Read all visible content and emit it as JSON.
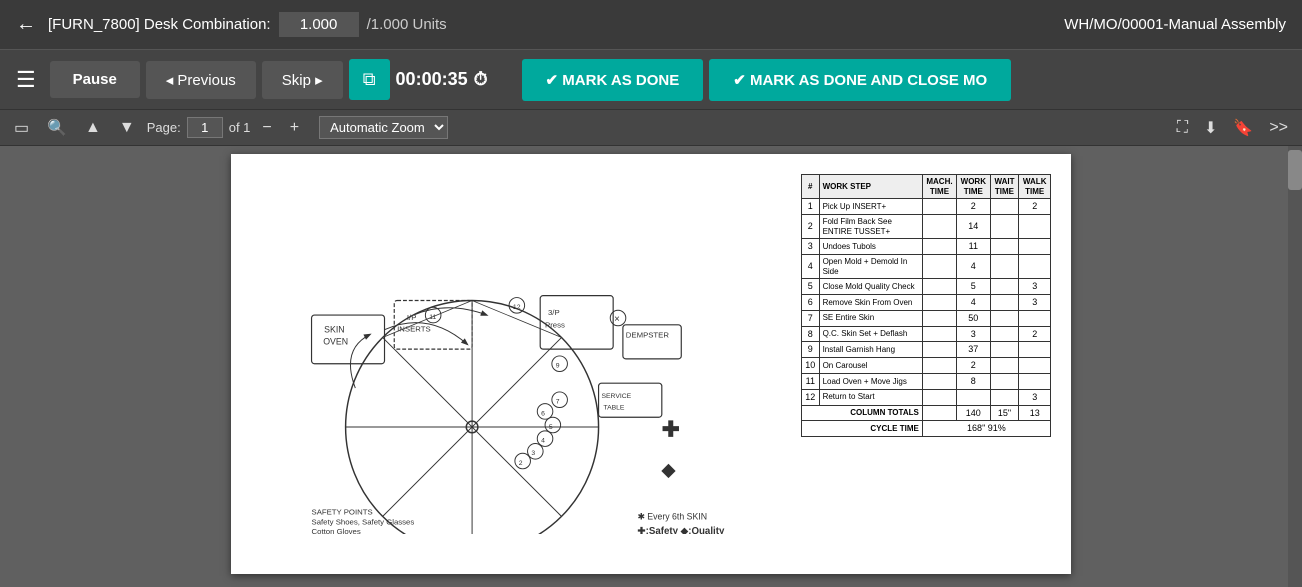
{
  "topbar": {
    "back_icon": "←",
    "title": "[FURN_7800] Desk Combination:",
    "quantity": "1.000",
    "units": "/1.000 Units",
    "mo_ref": "WH/MO/00001-Manual Assembly"
  },
  "actionbar": {
    "menu_icon": "☰",
    "pause_label": "Pause",
    "previous_label": "◂ Previous",
    "skip_label": "Skip ▸",
    "copy_icon": "⧉",
    "timer": "00:00:35",
    "timer_icon": "⏱",
    "mark_done_label": "✔ MARK AS DONE",
    "mark_done_close_label": "✔ MARK AS DONE AND CLOSE MO"
  },
  "pdf_toolbar": {
    "toggle_sidebar_icon": "▭",
    "search_icon": "🔍",
    "prev_page_icon": "▲",
    "next_page_icon": "▼",
    "page_label": "Page:",
    "page_current": "1",
    "page_total": "of 1",
    "zoom_out_icon": "−",
    "zoom_in_icon": "+",
    "zoom_level": "Automatic Zoom",
    "fullscreen_icon": "⛶",
    "download_icon": "⬇",
    "bookmark_icon": "🔖",
    "more_icon": ">>"
  },
  "work_steps": {
    "headers": [
      "#",
      "WORK STEP",
      "MACH. TIME",
      "WORK TIME",
      "WAIT TIME",
      "WALK TIME"
    ],
    "rows": [
      [
        "1",
        "Pick Up INSERT+",
        "",
        "2",
        "",
        "2"
      ],
      [
        "2",
        "Fold Film Back See ENTIRE TUSSET+",
        "",
        "14",
        "",
        ""
      ],
      [
        "3",
        "Undoes Tubols",
        "",
        "11",
        "",
        ""
      ],
      [
        "4",
        "Open Mold + Demold In Side",
        "",
        "4",
        "",
        ""
      ],
      [
        "5",
        "Close Mold Quality Check",
        "",
        "5",
        "",
        "3"
      ],
      [
        "6",
        "Remove Skin From Oven",
        "",
        "4",
        "",
        "3"
      ],
      [
        "7",
        "SE Entire Skin",
        "",
        "50",
        "",
        ""
      ],
      [
        "8",
        "Q.C. Skin Set + Deflash",
        "",
        "3",
        "",
        "2"
      ],
      [
        "9",
        "Install Garnish Hang",
        "",
        "37",
        "",
        ""
      ],
      [
        "10",
        "On Carousel",
        "",
        "2",
        "",
        ""
      ],
      [
        "11",
        "Load Oven + Move Jigs",
        "",
        "8",
        "",
        ""
      ],
      [
        "12",
        "Return to Start",
        "",
        "",
        "",
        "3"
      ]
    ],
    "totals_label": "COLUMN TOTALS",
    "totals_values": [
      "",
      "140",
      "15\"",
      "13"
    ],
    "cycle_time_label": "CYCLE TIME",
    "cycle_time_value": "168\" 91%"
  },
  "diagram": {
    "safety_label": "SAFETY POINTS",
    "safety_items": "Safety Shoes, Safety Glasses, Cotton Gloves",
    "legend_safety": "✚ Safety",
    "legend_quality": "◆ Quality"
  }
}
